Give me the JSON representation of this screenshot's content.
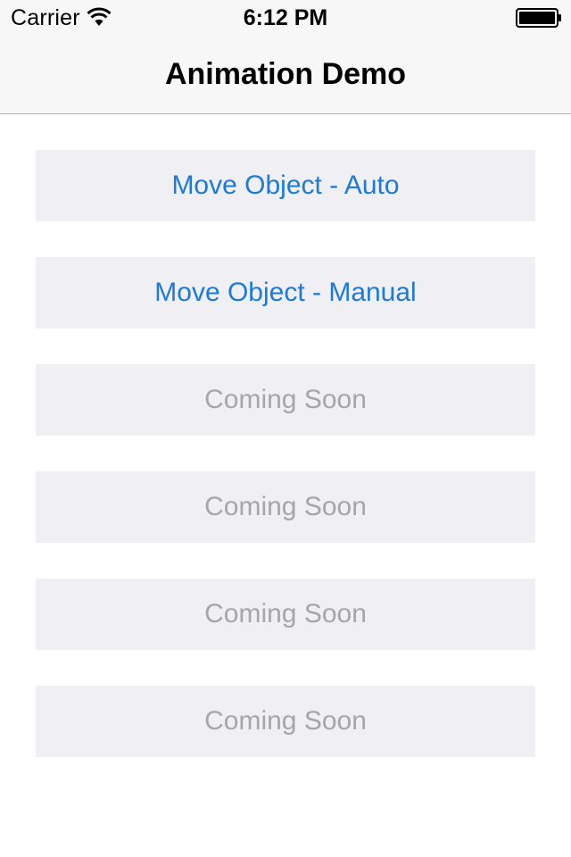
{
  "status_bar": {
    "carrier": "Carrier",
    "time": "6:12 PM"
  },
  "nav": {
    "title": "Animation Demo"
  },
  "buttons": [
    {
      "label": "Move Object - Auto",
      "enabled": true
    },
    {
      "label": "Move Object - Manual",
      "enabled": true
    },
    {
      "label": "Coming Soon",
      "enabled": false
    },
    {
      "label": "Coming Soon",
      "enabled": false
    },
    {
      "label": "Coming Soon",
      "enabled": false
    },
    {
      "label": "Coming Soon",
      "enabled": false
    }
  ],
  "colors": {
    "accent": "#1e7ad9",
    "disabled_text": "#a6a6aa",
    "button_bg": "#efeff4",
    "navbar_bg": "#f7f7f7"
  },
  "icons": [
    "wifi-icon",
    "battery-icon"
  ]
}
